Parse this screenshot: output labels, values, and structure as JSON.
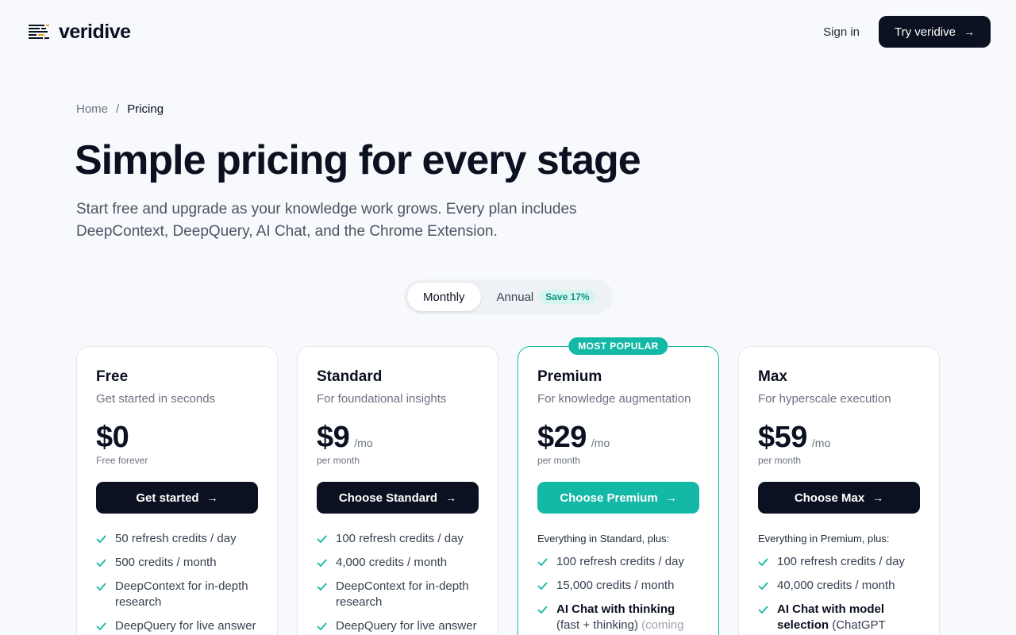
{
  "header": {
    "brand": "veridive",
    "signin": "Sign in",
    "cta": "Try veridive"
  },
  "breadcrumb": {
    "home": "Home",
    "sep": "/",
    "current": "Pricing"
  },
  "hero": {
    "title": "Simple pricing for every stage",
    "subtitle": "Start free and upgrade as your knowledge work grows. Every plan includes DeepContext, DeepQuery, AI Chat, and the Chrome Extension."
  },
  "billing": {
    "monthly": "Monthly",
    "annual": "Annual",
    "save": "Save 17%",
    "selected": "Monthly"
  },
  "colors": {
    "accent": "#14b8a6",
    "dark": "#0b1120",
    "logo_accent": "#e9a21c"
  },
  "plans": [
    {
      "name": "Free",
      "tagline": "Get started in seconds",
      "price": "$0",
      "per": "",
      "note": "Free forever",
      "cta": "Get started",
      "plus": "",
      "features": [
        {
          "text": "50 refresh credits / day"
        },
        {
          "text": "500 credits / month"
        },
        {
          "text": "DeepContext for in-depth research"
        },
        {
          "text": "DeepQuery for live answer"
        }
      ]
    },
    {
      "name": "Standard",
      "tagline": "For foundational insights",
      "price": "$9",
      "per": "/mo",
      "note": "per month",
      "cta": "Choose Standard",
      "plus": "",
      "features": [
        {
          "text": "100 refresh credits / day"
        },
        {
          "text": "4,000 credits / month"
        },
        {
          "text": "DeepContext for in-depth research"
        },
        {
          "text": "DeepQuery for live answer"
        }
      ]
    },
    {
      "name": "Premium",
      "tagline": "For knowledge augmentation",
      "price": "$29",
      "per": "/mo",
      "note": "per month",
      "cta": "Choose Premium",
      "plus": "Everything in Standard, plus:",
      "badge": "MOST POPULAR",
      "features": [
        {
          "text": "100 refresh credits / day"
        },
        {
          "text": "15,000 credits / month"
        },
        {
          "bold": "AI Chat with thinking",
          "text": " (fast + thinking)",
          "muted": " (coming June)"
        }
      ]
    },
    {
      "name": "Max",
      "tagline": "For hyperscale execution",
      "price": "$59",
      "per": "/mo",
      "note": "per month",
      "cta": "Choose Max",
      "plus": "Everything in Premium, plus:",
      "features": [
        {
          "text": "100 refresh credits / day"
        },
        {
          "text": "40,000 credits / month"
        },
        {
          "bold": "AI Chat with model selection",
          "text": " (ChatGPT"
        }
      ]
    }
  ]
}
